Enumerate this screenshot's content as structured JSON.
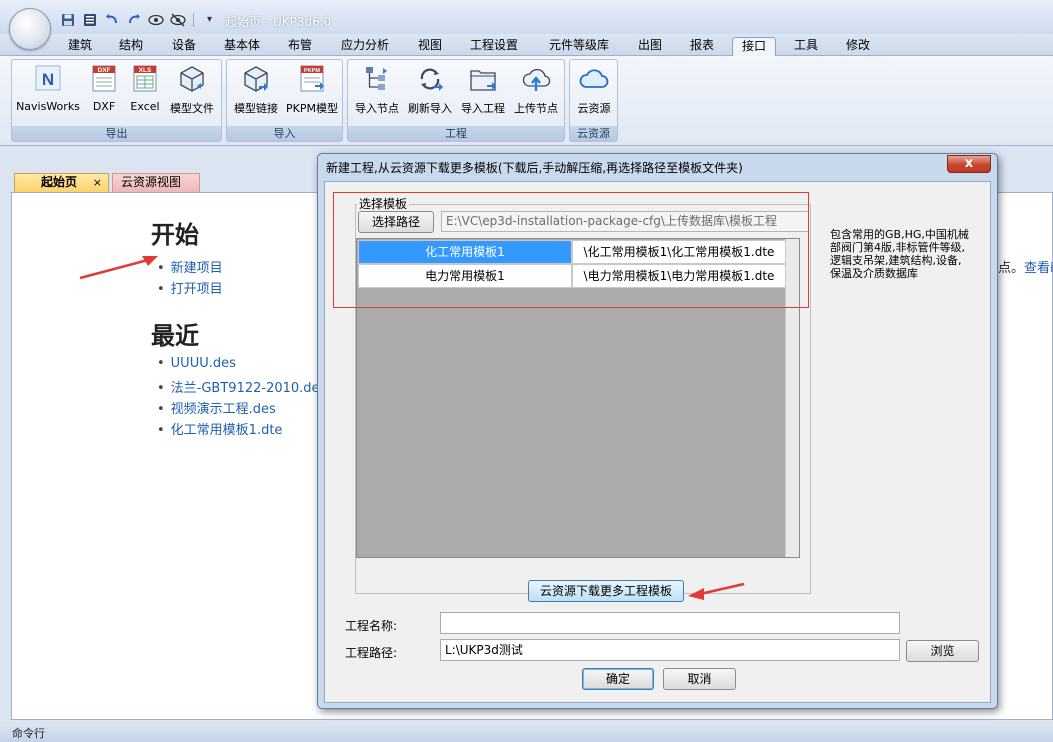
{
  "app": {
    "window_title": "起始页 - UKP3d6.0",
    "qat_icons": [
      "save-icon",
      "save-as-icon",
      "undo-icon",
      "redo-icon",
      "view-icon",
      "hide-icon",
      "dropdown-icon"
    ],
    "qat_overflow": "▾"
  },
  "ribbon": {
    "tabs": [
      "建筑",
      "结构",
      "设备",
      "基本体",
      "布管",
      "应力分析",
      "视图",
      "工程设置",
      "元件等级库",
      "出图",
      "报表",
      "接口",
      "工具",
      "修改"
    ],
    "active_tab": "接口",
    "groups": [
      {
        "caption": "导出",
        "buttons": [
          {
            "label": "NavisWorks",
            "icon": "navisworks-icon",
            "glyph": "N"
          },
          {
            "label": "DXF",
            "icon": "dxf-icon",
            "glyph": "DXF"
          },
          {
            "label": "Excel",
            "icon": "excel-icon",
            "glyph": "XLS"
          },
          {
            "label": "模型文件",
            "icon": "model-file-icon",
            "glyph": ""
          }
        ]
      },
      {
        "caption": "导入",
        "buttons": [
          {
            "label": "模型链接",
            "icon": "model-link-icon",
            "glyph": ""
          },
          {
            "label": "PKPM模型",
            "icon": "pkpm-icon",
            "glyph": "PKPM"
          }
        ]
      },
      {
        "caption": "工程",
        "buttons": [
          {
            "label": "导入节点",
            "icon": "import-node-icon",
            "glyph": ""
          },
          {
            "label": "刷新导入",
            "icon": "refresh-import-icon",
            "glyph": ""
          },
          {
            "label": "导入工程",
            "icon": "import-project-icon",
            "glyph": ""
          },
          {
            "label": "上传节点",
            "icon": "upload-node-icon",
            "glyph": ""
          }
        ]
      },
      {
        "caption": "云资源",
        "buttons": [
          {
            "label": "云资源",
            "icon": "cloud-icon",
            "glyph": ""
          }
        ]
      }
    ]
  },
  "doc_tabs": {
    "start": "起始页",
    "start_close": "×",
    "cloud": "云资源视图"
  },
  "start_page": {
    "heading_start": "开始",
    "bullet": "•",
    "start_links": [
      "新建项目",
      "打开项目"
    ],
    "heading_recent": "最近",
    "recent_links": [
      "UUUU.des",
      "法兰-GBT9122-2010.des",
      "视频演示工程.des",
      "化工常用模板1.dte"
    ],
    "right_text": "点。",
    "right_link": "查看i"
  },
  "status_bar": {
    "text": "命令行"
  },
  "dialog": {
    "title": "新建工程,从云资源下载更多模板(下载后,手动解压缩,再选择路径至模板文件夹)",
    "close_symbol": "x",
    "group_label": "选择模板",
    "select_path_button": "选择路径",
    "path_value": "E:\\VC\\ep3d-installation-package-cfg\\上传数据库\\模板工程",
    "templates": [
      {
        "name": "化工常用模板1",
        "path": "\\化工常用模板1\\化工常用模板1.dte",
        "selected": true
      },
      {
        "name": "电力常用模板1",
        "path": "\\电力常用模板1\\电力常用模板1.dte",
        "selected": false
      }
    ],
    "description": "包含常用的GB,HG,中国机械部阀门第4版,非标管件等级,逻辑支吊架,建筑结构,设备,保温及介质数据库",
    "download_button": "云资源下载更多工程模板",
    "project_name_label": "工程名称:",
    "project_name_value": "",
    "project_path_label": "工程路径:",
    "project_path_value": "L:\\UKP3d测试",
    "browse_button": "浏览",
    "ok_button": "确定",
    "cancel_button": "取消"
  },
  "colors": {
    "selected_row": "#3399ff",
    "annotation_red": "#e03a3a",
    "link_blue": "#1f5fb0"
  }
}
